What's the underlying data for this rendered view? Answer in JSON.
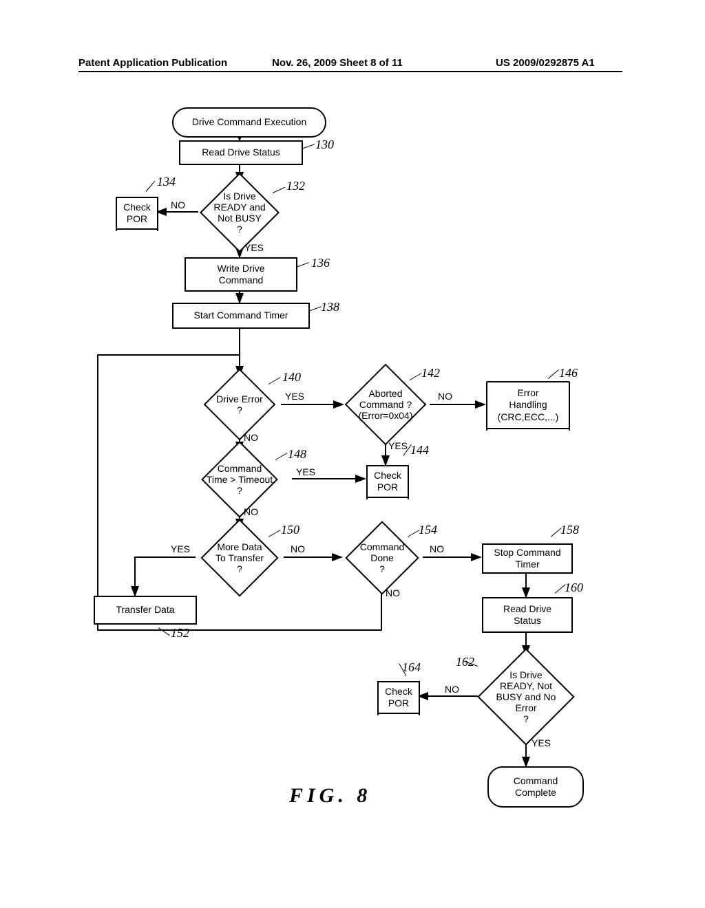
{
  "header": {
    "left": "Patent Application Publication",
    "mid": "Nov. 26, 2009  Sheet 8 of 11",
    "right": "US 2009/0292875 A1"
  },
  "figure_label": "FIG.  8",
  "yes": "YES",
  "no": "NO",
  "nodes": {
    "start": "Drive  Command  Execution",
    "n130": "Read  Drive  Status",
    "n132_l1": "Is  Drive",
    "n132_l2": "READY  and",
    "n132_l3": "Not  BUSY",
    "n132_l4": "?",
    "n134_l1": "Check",
    "n134_l2": "POR",
    "n136_l1": "Write  Drive",
    "n136_l2": "Command",
    "n138": "Start  Command  Timer",
    "n140_l1": "Drive  Error",
    "n140_l2": "?",
    "n142_l1": "Aborted",
    "n142_l2": "Command ?",
    "n142_l3": "(Error=0x04)",
    "n144_l1": "Check",
    "n144_l2": "POR",
    "n146_l1": "Error",
    "n146_l2": "Handling",
    "n146_l3": "(CRC,ECC,...)",
    "n148_l1": "Command",
    "n148_l2": "Time  >  Timeout",
    "n148_l3": "?",
    "n150_l1": "More  Data",
    "n150_l2": "To  Transfer",
    "n150_l3": "?",
    "n152": "Transfer  Data",
    "n154_l1": "Command",
    "n154_l2": "Done",
    "n154_l3": "?",
    "n158_l1": "Stop  Command",
    "n158_l2": "Timer",
    "n160_l1": "Read  Drive",
    "n160_l2": "Status",
    "n162_l1": "Is  Drive",
    "n162_l2": "READY,  Not",
    "n162_l3": "BUSY  and  No",
    "n162_l4": "Error",
    "n162_l5": "?",
    "n164_l1": "Check",
    "n164_l2": "POR",
    "end_l1": "Command",
    "end_l2": "Complete"
  },
  "refs": {
    "r130": "130",
    "r132": "132",
    "r134": "134",
    "r136": "136",
    "r138": "138",
    "r140": "140",
    "r142": "142",
    "r144": "144",
    "r146": "146",
    "r148": "148",
    "r150": "150",
    "r152": "152",
    "r154": "154",
    "r158": "158",
    "r160": "160",
    "r162": "162",
    "r164": "164"
  },
  "chart_data": {
    "type": "flowchart",
    "title": "FIG. 8",
    "nodes": [
      {
        "id": "start",
        "type": "terminator",
        "label": "Drive Command Execution"
      },
      {
        "id": "130",
        "type": "process",
        "label": "Read Drive Status"
      },
      {
        "id": "132",
        "type": "decision",
        "label": "Is Drive READY and Not BUSY ?"
      },
      {
        "id": "134",
        "type": "subroutine",
        "label": "Check POR"
      },
      {
        "id": "136",
        "type": "process",
        "label": "Write Drive Command"
      },
      {
        "id": "138",
        "type": "process",
        "label": "Start Command Timer"
      },
      {
        "id": "140",
        "type": "decision",
        "label": "Drive Error ?"
      },
      {
        "id": "142",
        "type": "decision",
        "label": "Aborted Command ? (Error=0x04)"
      },
      {
        "id": "144",
        "type": "subroutine",
        "label": "Check POR"
      },
      {
        "id": "146",
        "type": "subroutine",
        "label": "Error Handling (CRC,ECC,...)"
      },
      {
        "id": "148",
        "type": "decision",
        "label": "Command Time > Timeout ?"
      },
      {
        "id": "150",
        "type": "decision",
        "label": "More Data To Transfer ?"
      },
      {
        "id": "152",
        "type": "process",
        "label": "Transfer Data"
      },
      {
        "id": "154",
        "type": "decision",
        "label": "Command Done ?"
      },
      {
        "id": "158",
        "type": "process",
        "label": "Stop Command Timer"
      },
      {
        "id": "160",
        "type": "process",
        "label": "Read Drive Status"
      },
      {
        "id": "162",
        "type": "decision",
        "label": "Is Drive READY, Not BUSY and No Error ?"
      },
      {
        "id": "164",
        "type": "subroutine",
        "label": "Check POR"
      },
      {
        "id": "end",
        "type": "terminator",
        "label": "Command Complete"
      }
    ],
    "edges": [
      {
        "from": "start",
        "to": "130"
      },
      {
        "from": "130",
        "to": "132"
      },
      {
        "from": "132",
        "to": "134",
        "label": "NO"
      },
      {
        "from": "132",
        "to": "136",
        "label": "YES"
      },
      {
        "from": "136",
        "to": "138"
      },
      {
        "from": "138",
        "to": "140"
      },
      {
        "from": "140",
        "to": "142",
        "label": "YES"
      },
      {
        "from": "140",
        "to": "148",
        "label": "NO"
      },
      {
        "from": "142",
        "to": "146",
        "label": "NO"
      },
      {
        "from": "142",
        "to": "144",
        "label": "YES"
      },
      {
        "from": "148",
        "to": "144",
        "label": "YES"
      },
      {
        "from": "148",
        "to": "150",
        "label": "NO"
      },
      {
        "from": "150",
        "to": "152",
        "label": "YES"
      },
      {
        "from": "150",
        "to": "154",
        "label": "NO"
      },
      {
        "from": "152",
        "to": "140"
      },
      {
        "from": "154",
        "to": "140",
        "label": "NO"
      },
      {
        "from": "154",
        "to": "158",
        "label": "NO"
      },
      {
        "from": "158",
        "to": "160"
      },
      {
        "from": "160",
        "to": "162"
      },
      {
        "from": "162",
        "to": "164",
        "label": "NO"
      },
      {
        "from": "162",
        "to": "end",
        "label": "YES"
      }
    ]
  }
}
